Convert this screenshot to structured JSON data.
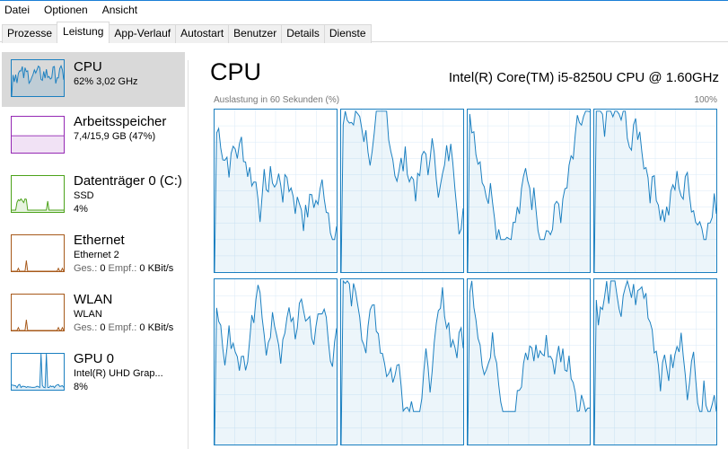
{
  "menu": [
    "Datei",
    "Optionen",
    "Ansicht"
  ],
  "tabs": [
    "Prozesse",
    "Leistung",
    "App-Verlauf",
    "Autostart",
    "Benutzer",
    "Details",
    "Dienste"
  ],
  "active_tab": "Leistung",
  "sidebar": [
    {
      "name": "CPU",
      "line1": "62%  3,02 GHz",
      "color": "#1a7fc0",
      "utilization": 0.62
    },
    {
      "name": "Arbeitsspeicher",
      "line1": "7,4/15,9 GB (47%)",
      "color": "#9528b4",
      "utilization": 0.47
    },
    {
      "name": "Datenträger 0 (C:)",
      "line1": "SSD",
      "line2": "4%",
      "color": "#4ca21a",
      "utilization": 0.04
    },
    {
      "name": "Ethernet",
      "line1": "Ethernet 2",
      "line2a": "Ges.:",
      "line2b": "0",
      "line2c": "Empf.:",
      "line2d": "0 KBit/s",
      "color": "#a7591a"
    },
    {
      "name": "WLAN",
      "line1": "WLAN",
      "line2a": "Ges.:",
      "line2b": "0",
      "line2c": "Empf.:",
      "line2d": "0 KBit/s",
      "color": "#a7591a"
    },
    {
      "name": "GPU 0",
      "line1": "Intel(R) UHD Grap...",
      "line2": "8%",
      "color": "#1a7fc0",
      "utilization": 0.08
    }
  ],
  "main": {
    "title": "CPU",
    "processor": "Intel(R) Core(TM) i5-8250U CPU @ 1.60GHz",
    "graph_label": "Auslastung in 60 Sekunden (%)",
    "max_label": "100%"
  }
}
